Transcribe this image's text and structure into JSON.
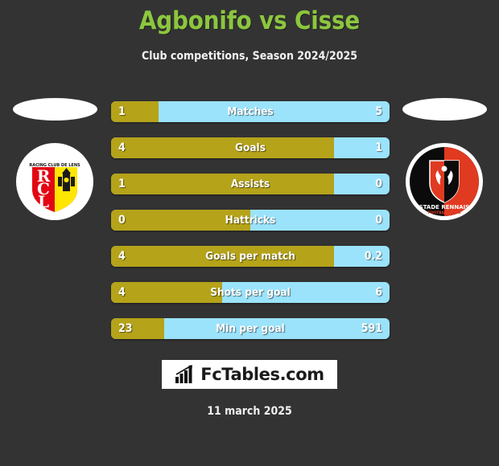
{
  "header": {
    "title": "Agbonifo vs Cisse",
    "subtitle": "Club competitions, Season 2024/2025",
    "title_color": "#8CC63E"
  },
  "theme": {
    "background": "#333333",
    "home_color": "#B5A31A",
    "away_color": "#9BE3FB",
    "text_color": "#FFFFFF"
  },
  "home": {
    "club_name": "RACING CLUB DE LENS",
    "club_short": "RCL",
    "emblem": "rc-lens-crest",
    "photo": "player-photo-placeholder"
  },
  "away": {
    "club_name": "STADE RENNAIS",
    "club_sub": "FOOTBALL CLUB",
    "emblem": "stade-rennais-crest",
    "photo": "player-photo-placeholder"
  },
  "chart_data": {
    "type": "bar",
    "title": "Agbonifo vs Cisse",
    "subtitle": "Club competitions, Season 2024/2025",
    "orientation": "horizontal-diverging",
    "series": [
      {
        "name": "Agbonifo",
        "color": "#B5A31A"
      },
      {
        "name": "Cisse",
        "color": "#9BE3FB"
      }
    ],
    "categories": [
      "Matches",
      "Goals",
      "Assists",
      "Hattricks",
      "Goals per match",
      "Shots per goal",
      "Min per goal"
    ],
    "rows": [
      {
        "label": "Matches",
        "home": "1",
        "away": "5",
        "home_pct": 17
      },
      {
        "label": "Goals",
        "home": "4",
        "away": "1",
        "home_pct": 80
      },
      {
        "label": "Assists",
        "home": "1",
        "away": "0",
        "home_pct": 80
      },
      {
        "label": "Hattricks",
        "home": "0",
        "away": "0",
        "home_pct": 50
      },
      {
        "label": "Goals per match",
        "home": "4",
        "away": "0.2",
        "home_pct": 80
      },
      {
        "label": "Shots per goal",
        "home": "4",
        "away": "6",
        "home_pct": 40
      },
      {
        "label": "Min per goal",
        "home": "23",
        "away": "591",
        "home_pct": 19
      }
    ]
  },
  "footer": {
    "logo_text": "FcTables.com",
    "logo_icon": "bar-chart-icon",
    "date": "11 march 2025"
  }
}
